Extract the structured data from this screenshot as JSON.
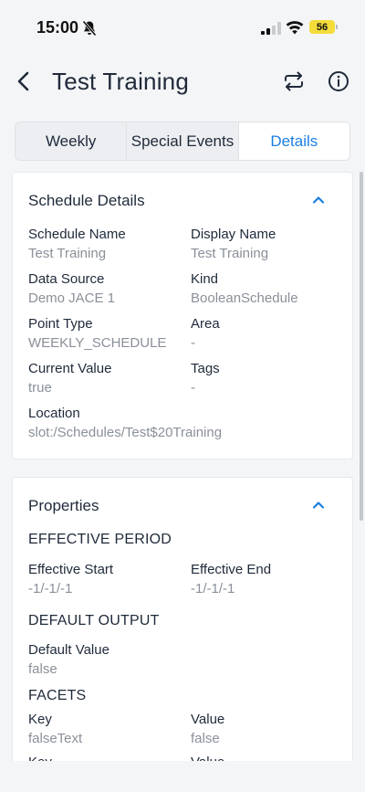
{
  "status_bar": {
    "time": "15:00",
    "battery": "56"
  },
  "header": {
    "title": "Test Training"
  },
  "tabs": [
    {
      "label": "Weekly"
    },
    {
      "label": "Special Events"
    },
    {
      "label": "Details"
    }
  ],
  "schedule_details": {
    "title": "Schedule Details",
    "fields": [
      {
        "label": "Schedule Name",
        "value": "Test Training"
      },
      {
        "label": "Display Name",
        "value": "Test Training"
      },
      {
        "label": "Data Source",
        "value": "Demo JACE 1"
      },
      {
        "label": "Kind",
        "value": "BooleanSchedule"
      },
      {
        "label": "Point Type",
        "value": "WEEKLY_SCHEDULE"
      },
      {
        "label": "Area",
        "value": "-"
      },
      {
        "label": "Current Value",
        "value": "true"
      },
      {
        "label": "Tags",
        "value": "-"
      },
      {
        "label": "Location",
        "value": "slot:/Schedules/Test$20Training"
      }
    ]
  },
  "properties": {
    "title": "Properties",
    "effective_period": {
      "heading": "EFFECTIVE PERIOD",
      "start_label": "Effective Start",
      "start_value": "-1/-1/-1",
      "end_label": "Effective End",
      "end_value": "-1/-1/-1"
    },
    "default_output": {
      "heading": "DEFAULT OUTPUT",
      "label": "Default Value",
      "value": "false"
    },
    "facets": {
      "heading": "FACETS",
      "rows": [
        {
          "key_label": "Key",
          "key": "falseText",
          "value_label": "Value",
          "value": "false"
        },
        {
          "key_label": "Key",
          "key": "",
          "value_label": "Value",
          "value": ""
        }
      ]
    }
  },
  "colors": {
    "accent": "#1a7fe0",
    "muted_text": "#8a9099",
    "text": "#1f2a3a"
  }
}
